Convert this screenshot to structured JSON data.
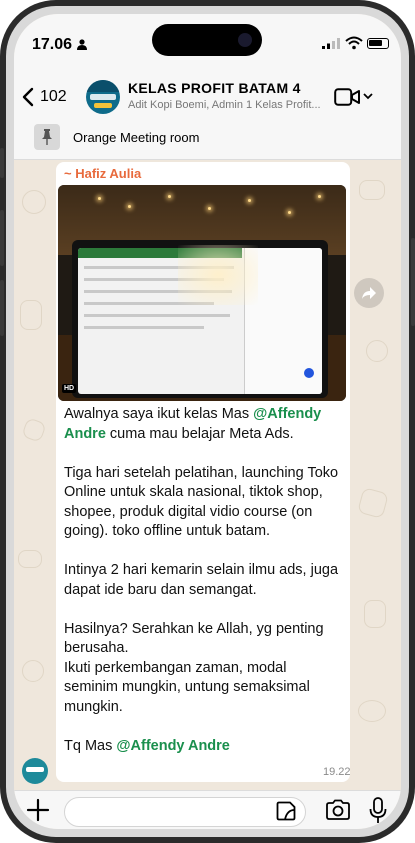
{
  "status": {
    "time": "17.06"
  },
  "header": {
    "back_count": "102",
    "group_name": "KELAS PROFIT BATAM 4",
    "group_members": "Adit Kopi Boemi, Admin 1 Kelas Profit..."
  },
  "pinned": {
    "text": "Orange Meeting room"
  },
  "message": {
    "sender": "~ Hafiz Aulia",
    "image_badge": "HD",
    "line1_a": "Awalnya saya ikut kelas Mas ",
    "mention": "@Affendy Andre",
    "line1_b": " cuma mau belajar Meta Ads.",
    "para2": "Tiga hari setelah pelatihan, launching Toko Online  untuk skala nasional, tiktok shop, shopee, produk digital vidio course (on going). toko offline untuk batam.",
    "para3": "Intinya 2 hari kemarin selain ilmu ads, juga dapat ide baru dan semangat.",
    "para4a": "Hasilnya? Serahkan ke Allah, yg penting berusaha.",
    "para4b": "Ikuti perkembangan zaman, modal seminim mungkin, untung semaksimal mungkin.",
    "last_a": "Tq Mas ",
    "last_mention": "@Affendy Andre",
    "time": "19.22"
  },
  "icons": [
    "person-icon",
    "signal-icon",
    "wifi-icon",
    "battery-icon",
    "back-chevron-icon",
    "video-call-icon",
    "chevron-down-icon",
    "pin-icon",
    "forward-icon",
    "plus-icon",
    "sticker-icon",
    "camera-icon",
    "mic-icon"
  ]
}
